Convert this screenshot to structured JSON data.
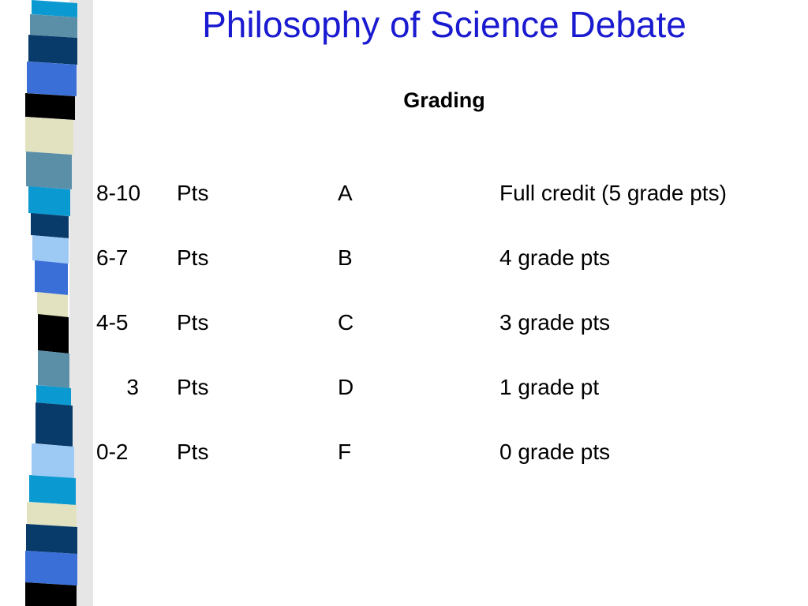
{
  "slide": {
    "title": "Philosophy of Science Debate",
    "subtitle": "Grading",
    "rows": [
      {
        "range": "8-10",
        "unit": "Pts",
        "grade": "A",
        "credit": "Full credit (5 grade pts)"
      },
      {
        "range": "6-7",
        "unit": "Pts",
        "grade": "B",
        "credit": "4 grade pts"
      },
      {
        "range": "4-5",
        "unit": "Pts",
        "grade": "C",
        "credit": "3 grade pts"
      },
      {
        "range": "3",
        "unit": "Pts",
        "grade": "D",
        "credit": "1 grade pt"
      },
      {
        "range": "0-2",
        "unit": "Pts",
        "grade": "F",
        "credit": "0 grade pts"
      }
    ]
  },
  "colors": {
    "title": "#1a1ad0",
    "stripe_palette": [
      "#0a99d0",
      "#5b8fa8",
      "#083a6a",
      "#3a6fd8",
      "#000000",
      "#e2e2c0",
      "#9dc9f5"
    ]
  }
}
